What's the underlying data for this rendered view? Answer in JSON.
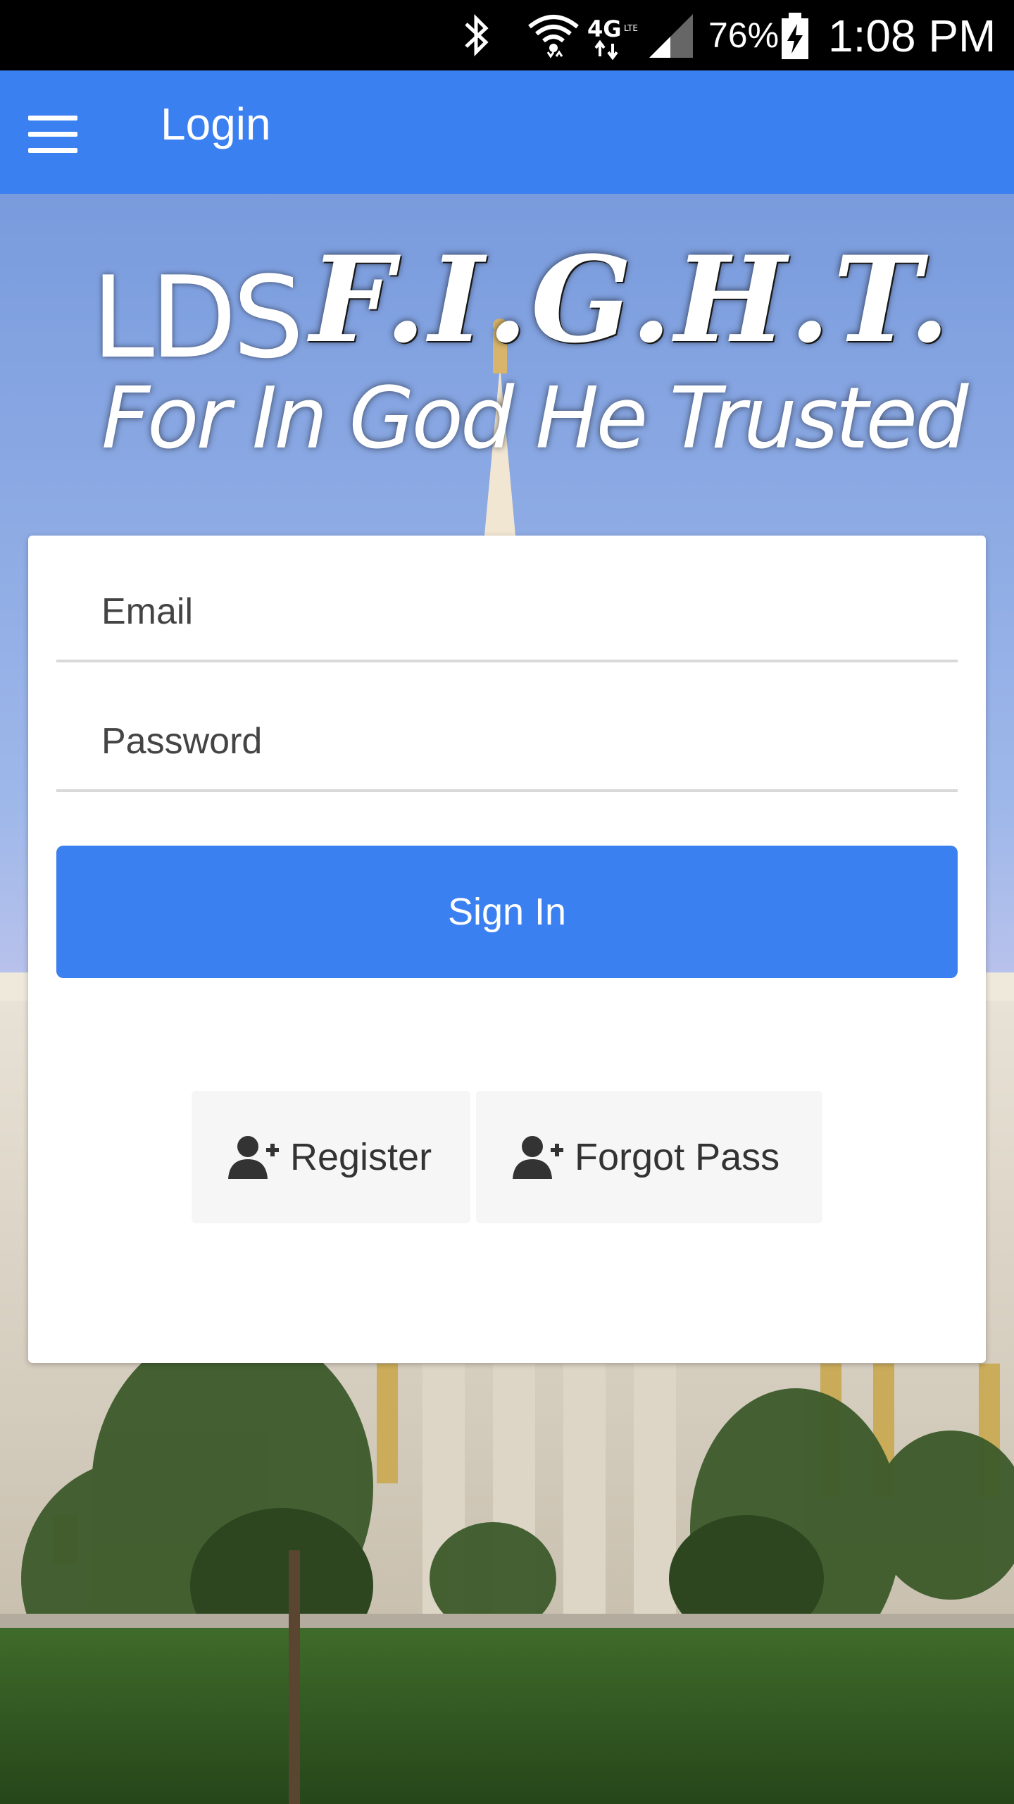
{
  "status_bar": {
    "battery_percent": "76%",
    "time": "1:08 PM",
    "icons": [
      "bluetooth-icon",
      "wifi-icon",
      "lte-4g-icon",
      "signal-icon",
      "battery-charging-icon"
    ]
  },
  "app_bar": {
    "title": "Login",
    "menu_icon": "hamburger-menu-icon"
  },
  "logo": {
    "prefix": "LDS",
    "name": "F.I.G.H.T.",
    "tagline": "For In God He Trusted"
  },
  "form": {
    "email_placeholder": "Email",
    "password_placeholder": "Password",
    "sign_in_label": "Sign In",
    "register_label": "Register",
    "forgot_label": "Forgot Pass",
    "register_icon": "add-user-icon",
    "forgot_icon": "add-user-icon"
  },
  "colors": {
    "primary": "#3b80f0",
    "status_bar": "#000000",
    "card": "#ffffff",
    "secondary_button": "#f6f6f6"
  }
}
